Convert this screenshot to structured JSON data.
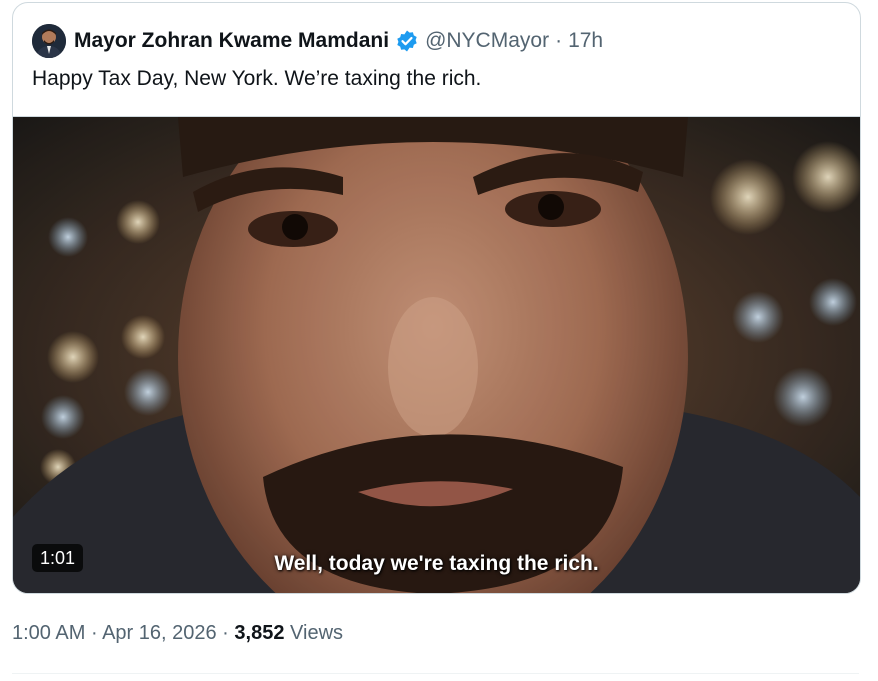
{
  "tweet": {
    "author": {
      "display_name": "Mayor Zohran Kwame Mamdani",
      "handle": "@NYCMayor",
      "verified": true,
      "avatar_icon": "person-avatar"
    },
    "separator": "·",
    "relative_time": "17h",
    "text": "Happy Tax Day, New York. We’re taxing the rich.",
    "media": {
      "type": "video",
      "duration": "1:01",
      "caption": "Well, today we're taxing the rich."
    },
    "footer": {
      "time": "1:00 AM",
      "date": "Apr 16, 2026",
      "views_count": "3,852",
      "views_label": "Views"
    }
  },
  "colors": {
    "text_primary": "#0f1419",
    "text_secondary": "#536471",
    "verified_blue": "#1d9bf0",
    "border": "#cfd9de"
  }
}
